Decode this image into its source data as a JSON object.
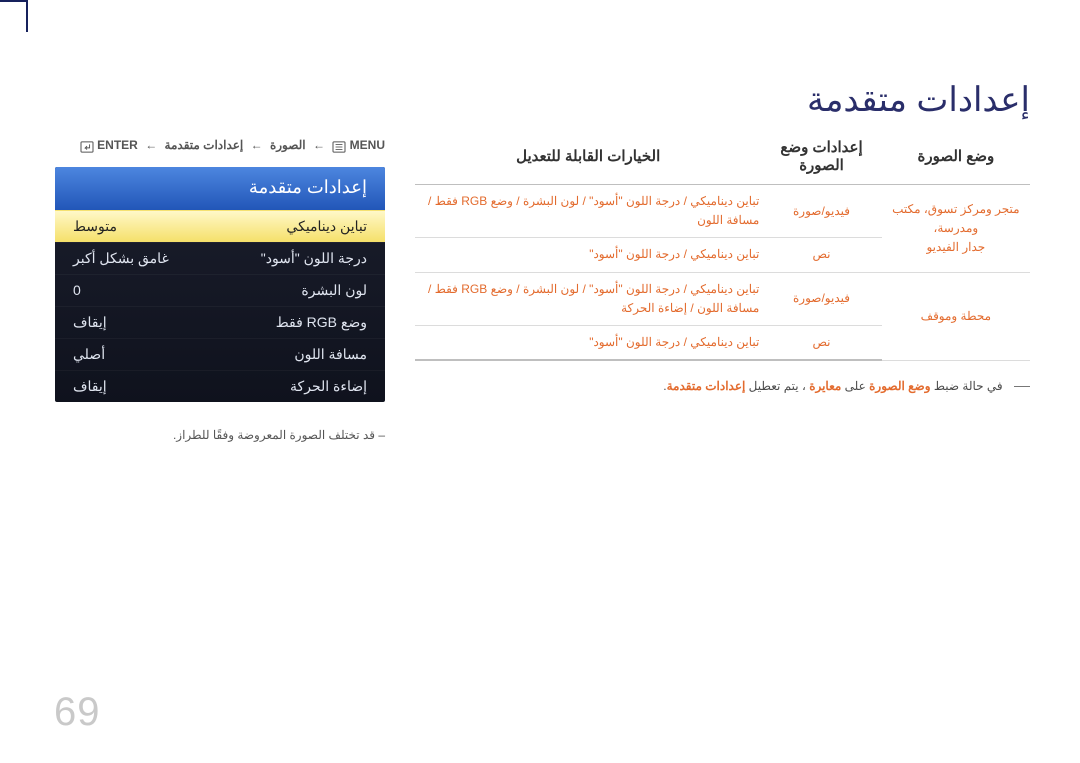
{
  "page": {
    "title": "إعدادات متقدمة",
    "number": "69"
  },
  "breadcrumb": {
    "menu": "MENU",
    "step1": "الصورة",
    "step2": "إعدادات متقدمة",
    "enter": "ENTER",
    "arrow": "←"
  },
  "osd": {
    "header": "إعدادات متقدمة",
    "rows": [
      {
        "label": "تباين ديناميكي",
        "value": "متوسط",
        "selected": true
      },
      {
        "label": "درجة اللون \"أسود\"",
        "value": "غامق بشكل أكبر"
      },
      {
        "label": "لون البشرة",
        "value": "0"
      },
      {
        "label": "وضع RGB فقط",
        "value": "إيقاف"
      },
      {
        "label": "مسافة اللون",
        "value": "أصلي"
      },
      {
        "label": "إضاءة الحركة",
        "value": "إيقاف"
      }
    ]
  },
  "footnote": "– قد تختلف الصورة المعروضة وفقًا للطراز.",
  "table": {
    "headers": {
      "mode": "وضع الصورة",
      "settings": "إعدادات وضع الصورة",
      "adjustable": "الخيارات القابلة للتعديل"
    },
    "rows": [
      {
        "mode": "متجر ومركز تسوق، مكتب ومدرسة،",
        "settings": "فيديو/صورة",
        "opts": "تباين ديناميكي / درجة اللون \"أسود\" / لون البشرة / وضع RGB فقط / مسافة اللون"
      },
      {
        "mode": "جدار الفيديو",
        "settings": "نص",
        "opts": "تباين ديناميكي / درجة اللون \"أسود\""
      },
      {
        "mode": "محطة وموقف",
        "settings": "فيديو/صورة",
        "opts": "تباين ديناميكي / درجة اللون \"أسود\" / لون البشرة / وضع RGB فقط / مسافة اللون / إضاءة الحركة"
      },
      {
        "mode": "",
        "settings": "نص",
        "opts": "تباين ديناميكي / درجة اللون \"أسود\""
      }
    ],
    "footnote_pre": "في حالة ضبط",
    "footnote_hl1": "وضع الصورة",
    "footnote_mid": "على",
    "footnote_hl2": "معايرة",
    "footnote_post": "، يتم تعطيل",
    "footnote_hl3": "إعدادات متقدمة",
    "footnote_end": "."
  }
}
